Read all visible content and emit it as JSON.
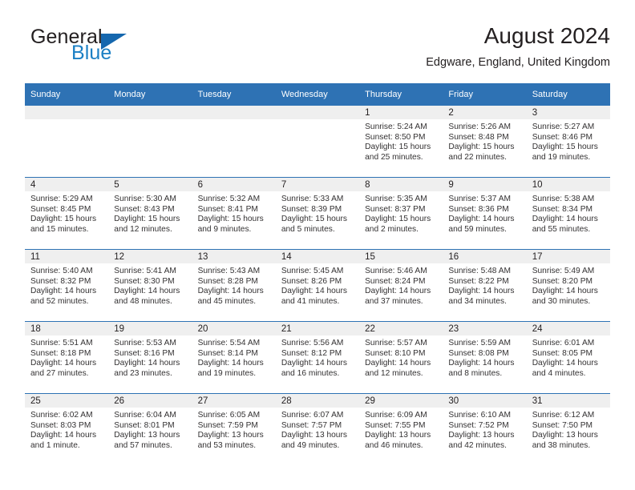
{
  "brand": {
    "name_top": "General",
    "name_bottom": "Blue",
    "accent_color": "#1567ae",
    "text_color": "#231f20"
  },
  "header": {
    "title": "August 2024",
    "subtitle": "Edgware, England, United Kingdom"
  },
  "calendar": {
    "header_bg": "#2e72b4",
    "daynum_bg": "#efefef",
    "weekday_headers": [
      "Sunday",
      "Monday",
      "Tuesday",
      "Wednesday",
      "Thursday",
      "Friday",
      "Saturday"
    ],
    "weeks": [
      [
        {
          "day": "",
          "sunrise": "",
          "sunset": "",
          "daylight_line1": "",
          "daylight_line2": ""
        },
        {
          "day": "",
          "sunrise": "",
          "sunset": "",
          "daylight_line1": "",
          "daylight_line2": ""
        },
        {
          "day": "",
          "sunrise": "",
          "sunset": "",
          "daylight_line1": "",
          "daylight_line2": ""
        },
        {
          "day": "",
          "sunrise": "",
          "sunset": "",
          "daylight_line1": "",
          "daylight_line2": ""
        },
        {
          "day": "1",
          "sunrise": "Sunrise: 5:24 AM",
          "sunset": "Sunset: 8:50 PM",
          "daylight_line1": "Daylight: 15 hours",
          "daylight_line2": "and 25 minutes."
        },
        {
          "day": "2",
          "sunrise": "Sunrise: 5:26 AM",
          "sunset": "Sunset: 8:48 PM",
          "daylight_line1": "Daylight: 15 hours",
          "daylight_line2": "and 22 minutes."
        },
        {
          "day": "3",
          "sunrise": "Sunrise: 5:27 AM",
          "sunset": "Sunset: 8:46 PM",
          "daylight_line1": "Daylight: 15 hours",
          "daylight_line2": "and 19 minutes."
        }
      ],
      [
        {
          "day": "4",
          "sunrise": "Sunrise: 5:29 AM",
          "sunset": "Sunset: 8:45 PM",
          "daylight_line1": "Daylight: 15 hours",
          "daylight_line2": "and 15 minutes."
        },
        {
          "day": "5",
          "sunrise": "Sunrise: 5:30 AM",
          "sunset": "Sunset: 8:43 PM",
          "daylight_line1": "Daylight: 15 hours",
          "daylight_line2": "and 12 minutes."
        },
        {
          "day": "6",
          "sunrise": "Sunrise: 5:32 AM",
          "sunset": "Sunset: 8:41 PM",
          "daylight_line1": "Daylight: 15 hours",
          "daylight_line2": "and 9 minutes."
        },
        {
          "day": "7",
          "sunrise": "Sunrise: 5:33 AM",
          "sunset": "Sunset: 8:39 PM",
          "daylight_line1": "Daylight: 15 hours",
          "daylight_line2": "and 5 minutes."
        },
        {
          "day": "8",
          "sunrise": "Sunrise: 5:35 AM",
          "sunset": "Sunset: 8:37 PM",
          "daylight_line1": "Daylight: 15 hours",
          "daylight_line2": "and 2 minutes."
        },
        {
          "day": "9",
          "sunrise": "Sunrise: 5:37 AM",
          "sunset": "Sunset: 8:36 PM",
          "daylight_line1": "Daylight: 14 hours",
          "daylight_line2": "and 59 minutes."
        },
        {
          "day": "10",
          "sunrise": "Sunrise: 5:38 AM",
          "sunset": "Sunset: 8:34 PM",
          "daylight_line1": "Daylight: 14 hours",
          "daylight_line2": "and 55 minutes."
        }
      ],
      [
        {
          "day": "11",
          "sunrise": "Sunrise: 5:40 AM",
          "sunset": "Sunset: 8:32 PM",
          "daylight_line1": "Daylight: 14 hours",
          "daylight_line2": "and 52 minutes."
        },
        {
          "day": "12",
          "sunrise": "Sunrise: 5:41 AM",
          "sunset": "Sunset: 8:30 PM",
          "daylight_line1": "Daylight: 14 hours",
          "daylight_line2": "and 48 minutes."
        },
        {
          "day": "13",
          "sunrise": "Sunrise: 5:43 AM",
          "sunset": "Sunset: 8:28 PM",
          "daylight_line1": "Daylight: 14 hours",
          "daylight_line2": "and 45 minutes."
        },
        {
          "day": "14",
          "sunrise": "Sunrise: 5:45 AM",
          "sunset": "Sunset: 8:26 PM",
          "daylight_line1": "Daylight: 14 hours",
          "daylight_line2": "and 41 minutes."
        },
        {
          "day": "15",
          "sunrise": "Sunrise: 5:46 AM",
          "sunset": "Sunset: 8:24 PM",
          "daylight_line1": "Daylight: 14 hours",
          "daylight_line2": "and 37 minutes."
        },
        {
          "day": "16",
          "sunrise": "Sunrise: 5:48 AM",
          "sunset": "Sunset: 8:22 PM",
          "daylight_line1": "Daylight: 14 hours",
          "daylight_line2": "and 34 minutes."
        },
        {
          "day": "17",
          "sunrise": "Sunrise: 5:49 AM",
          "sunset": "Sunset: 8:20 PM",
          "daylight_line1": "Daylight: 14 hours",
          "daylight_line2": "and 30 minutes."
        }
      ],
      [
        {
          "day": "18",
          "sunrise": "Sunrise: 5:51 AM",
          "sunset": "Sunset: 8:18 PM",
          "daylight_line1": "Daylight: 14 hours",
          "daylight_line2": "and 27 minutes."
        },
        {
          "day": "19",
          "sunrise": "Sunrise: 5:53 AM",
          "sunset": "Sunset: 8:16 PM",
          "daylight_line1": "Daylight: 14 hours",
          "daylight_line2": "and 23 minutes."
        },
        {
          "day": "20",
          "sunrise": "Sunrise: 5:54 AM",
          "sunset": "Sunset: 8:14 PM",
          "daylight_line1": "Daylight: 14 hours",
          "daylight_line2": "and 19 minutes."
        },
        {
          "day": "21",
          "sunrise": "Sunrise: 5:56 AM",
          "sunset": "Sunset: 8:12 PM",
          "daylight_line1": "Daylight: 14 hours",
          "daylight_line2": "and 16 minutes."
        },
        {
          "day": "22",
          "sunrise": "Sunrise: 5:57 AM",
          "sunset": "Sunset: 8:10 PM",
          "daylight_line1": "Daylight: 14 hours",
          "daylight_line2": "and 12 minutes."
        },
        {
          "day": "23",
          "sunrise": "Sunrise: 5:59 AM",
          "sunset": "Sunset: 8:08 PM",
          "daylight_line1": "Daylight: 14 hours",
          "daylight_line2": "and 8 minutes."
        },
        {
          "day": "24",
          "sunrise": "Sunrise: 6:01 AM",
          "sunset": "Sunset: 8:05 PM",
          "daylight_line1": "Daylight: 14 hours",
          "daylight_line2": "and 4 minutes."
        }
      ],
      [
        {
          "day": "25",
          "sunrise": "Sunrise: 6:02 AM",
          "sunset": "Sunset: 8:03 PM",
          "daylight_line1": "Daylight: 14 hours",
          "daylight_line2": "and 1 minute."
        },
        {
          "day": "26",
          "sunrise": "Sunrise: 6:04 AM",
          "sunset": "Sunset: 8:01 PM",
          "daylight_line1": "Daylight: 13 hours",
          "daylight_line2": "and 57 minutes."
        },
        {
          "day": "27",
          "sunrise": "Sunrise: 6:05 AM",
          "sunset": "Sunset: 7:59 PM",
          "daylight_line1": "Daylight: 13 hours",
          "daylight_line2": "and 53 minutes."
        },
        {
          "day": "28",
          "sunrise": "Sunrise: 6:07 AM",
          "sunset": "Sunset: 7:57 PM",
          "daylight_line1": "Daylight: 13 hours",
          "daylight_line2": "and 49 minutes."
        },
        {
          "day": "29",
          "sunrise": "Sunrise: 6:09 AM",
          "sunset": "Sunset: 7:55 PM",
          "daylight_line1": "Daylight: 13 hours",
          "daylight_line2": "and 46 minutes."
        },
        {
          "day": "30",
          "sunrise": "Sunrise: 6:10 AM",
          "sunset": "Sunset: 7:52 PM",
          "daylight_line1": "Daylight: 13 hours",
          "daylight_line2": "and 42 minutes."
        },
        {
          "day": "31",
          "sunrise": "Sunrise: 6:12 AM",
          "sunset": "Sunset: 7:50 PM",
          "daylight_line1": "Daylight: 13 hours",
          "daylight_line2": "and 38 minutes."
        }
      ]
    ]
  }
}
